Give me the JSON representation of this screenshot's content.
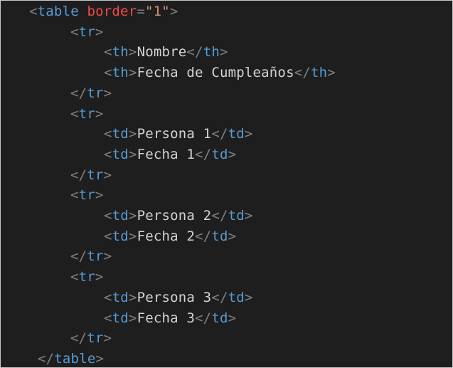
{
  "colors": {
    "background": "#1e1e1e",
    "punct": "#808080",
    "tag": "#569cd6",
    "attr": "#f44747",
    "str": "#ce9178",
    "text": "#d4d4d4"
  },
  "lines": [
    {
      "indent": 1,
      "tokens": [
        [
          "punct",
          "<"
        ],
        [
          "tag",
          "table"
        ],
        [
          "text",
          " "
        ],
        [
          "attr",
          "border"
        ],
        [
          "punct",
          "="
        ],
        [
          "str",
          "\"1\""
        ],
        [
          "punct",
          ">"
        ]
      ]
    },
    {
      "indent": 2,
      "tokens": [
        [
          "punct",
          "<"
        ],
        [
          "tag",
          "tr"
        ],
        [
          "punct",
          ">"
        ]
      ]
    },
    {
      "indent": 3,
      "tokens": [
        [
          "punct",
          "<"
        ],
        [
          "tag",
          "th"
        ],
        [
          "punct",
          ">"
        ],
        [
          "text",
          "Nombre"
        ],
        [
          "punct",
          "</"
        ],
        [
          "tag",
          "th"
        ],
        [
          "punct",
          ">"
        ]
      ]
    },
    {
      "indent": 3,
      "tokens": [
        [
          "punct",
          "<"
        ],
        [
          "tag",
          "th"
        ],
        [
          "punct",
          ">"
        ],
        [
          "text",
          "Fecha de Cumpleaños"
        ],
        [
          "punct",
          "</"
        ],
        [
          "tag",
          "th"
        ],
        [
          "punct",
          ">"
        ]
      ]
    },
    {
      "indent": 2,
      "tokens": [
        [
          "punct",
          "</"
        ],
        [
          "tag",
          "tr"
        ],
        [
          "punct",
          ">"
        ]
      ]
    },
    {
      "indent": 2,
      "tokens": [
        [
          "punct",
          "<"
        ],
        [
          "tag",
          "tr"
        ],
        [
          "punct",
          ">"
        ]
      ]
    },
    {
      "indent": 3,
      "tokens": [
        [
          "punct",
          "<"
        ],
        [
          "tag",
          "td"
        ],
        [
          "punct",
          ">"
        ],
        [
          "text",
          "Persona 1"
        ],
        [
          "punct",
          "</"
        ],
        [
          "tag",
          "td"
        ],
        [
          "punct",
          ">"
        ]
      ]
    },
    {
      "indent": 3,
      "tokens": [
        [
          "punct",
          "<"
        ],
        [
          "tag",
          "td"
        ],
        [
          "punct",
          ">"
        ],
        [
          "text",
          "Fecha 1"
        ],
        [
          "punct",
          "</"
        ],
        [
          "tag",
          "td"
        ],
        [
          "punct",
          ">"
        ]
      ]
    },
    {
      "indent": 2,
      "tokens": [
        [
          "punct",
          "</"
        ],
        [
          "tag",
          "tr"
        ],
        [
          "punct",
          ">"
        ]
      ]
    },
    {
      "indent": 2,
      "tokens": [
        [
          "punct",
          "<"
        ],
        [
          "tag",
          "tr"
        ],
        [
          "punct",
          ">"
        ]
      ]
    },
    {
      "indent": 3,
      "tokens": [
        [
          "punct",
          "<"
        ],
        [
          "tag",
          "td"
        ],
        [
          "punct",
          ">"
        ],
        [
          "text",
          "Persona 2"
        ],
        [
          "punct",
          "</"
        ],
        [
          "tag",
          "td"
        ],
        [
          "punct",
          ">"
        ]
      ]
    },
    {
      "indent": 3,
      "tokens": [
        [
          "punct",
          "<"
        ],
        [
          "tag",
          "td"
        ],
        [
          "punct",
          ">"
        ],
        [
          "text",
          "Fecha 2"
        ],
        [
          "punct",
          "</"
        ],
        [
          "tag",
          "td"
        ],
        [
          "punct",
          ">"
        ]
      ]
    },
    {
      "indent": 2,
      "tokens": [
        [
          "punct",
          "</"
        ],
        [
          "tag",
          "tr"
        ],
        [
          "punct",
          ">"
        ]
      ]
    },
    {
      "indent": 2,
      "tokens": [
        [
          "punct",
          "<"
        ],
        [
          "tag",
          "tr"
        ],
        [
          "punct",
          ">"
        ]
      ]
    },
    {
      "indent": 3,
      "tokens": [
        [
          "punct",
          "<"
        ],
        [
          "tag",
          "td"
        ],
        [
          "punct",
          ">"
        ],
        [
          "text",
          "Persona 3"
        ],
        [
          "punct",
          "</"
        ],
        [
          "tag",
          "td"
        ],
        [
          "punct",
          ">"
        ]
      ]
    },
    {
      "indent": 3,
      "tokens": [
        [
          "punct",
          "<"
        ],
        [
          "tag",
          "td"
        ],
        [
          "punct",
          ">"
        ],
        [
          "text",
          "Fecha 3"
        ],
        [
          "punct",
          "</"
        ],
        [
          "tag",
          "td"
        ],
        [
          "punct",
          ">"
        ]
      ]
    },
    {
      "indent": 2,
      "tokens": [
        [
          "punct",
          "</"
        ],
        [
          "tag",
          "tr"
        ],
        [
          "punct",
          ">"
        ]
      ]
    },
    {
      "indent": 0,
      "tokens": [
        [
          "punct",
          "</"
        ],
        [
          "tag",
          "table"
        ],
        [
          "punct",
          ">"
        ]
      ]
    }
  ]
}
